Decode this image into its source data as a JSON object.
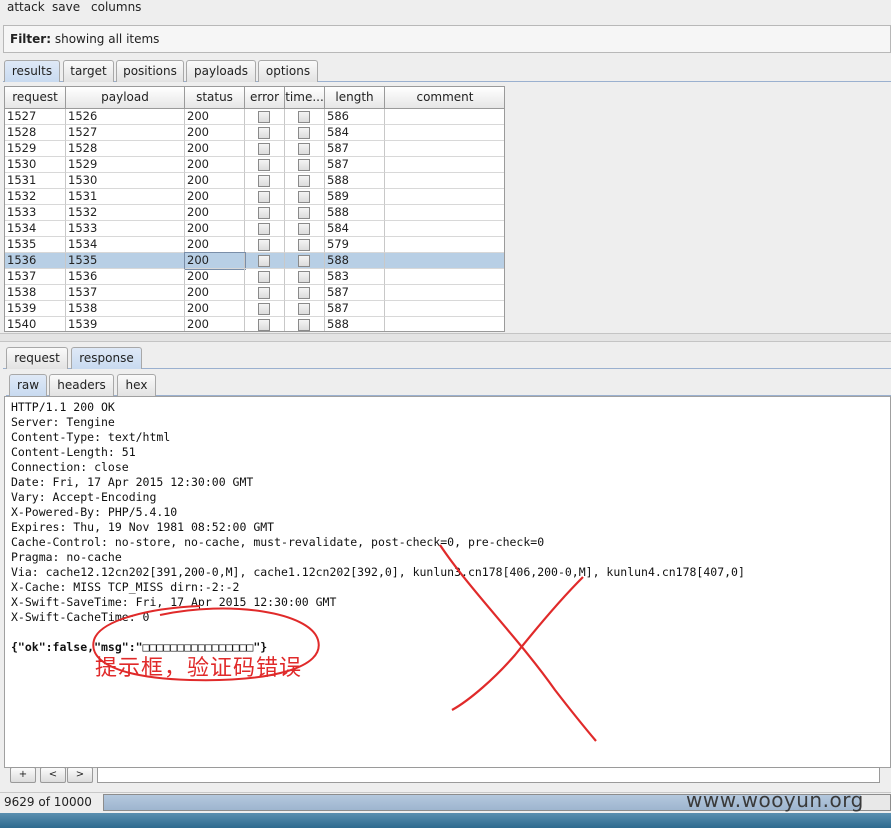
{
  "menu": {
    "attack": "attack",
    "save": "save",
    "columns": "columns"
  },
  "filter": {
    "label": "Filter:",
    "text": "showing all items"
  },
  "main_tabs": [
    {
      "label": "results",
      "active": true
    },
    {
      "label": "target",
      "active": false
    },
    {
      "label": "positions",
      "active": false
    },
    {
      "label": "payloads",
      "active": false
    },
    {
      "label": "options",
      "active": false
    }
  ],
  "table": {
    "columns": [
      "request",
      "payload",
      "status",
      "error",
      "time...",
      "length",
      "comment"
    ],
    "rows": [
      {
        "request": "1527",
        "payload": "1526",
        "status": "200",
        "length": "586"
      },
      {
        "request": "1528",
        "payload": "1527",
        "status": "200",
        "length": "584"
      },
      {
        "request": "1529",
        "payload": "1528",
        "status": "200",
        "length": "587"
      },
      {
        "request": "1530",
        "payload": "1529",
        "status": "200",
        "length": "587"
      },
      {
        "request": "1531",
        "payload": "1530",
        "status": "200",
        "length": "588"
      },
      {
        "request": "1532",
        "payload": "1531",
        "status": "200",
        "length": "589"
      },
      {
        "request": "1533",
        "payload": "1532",
        "status": "200",
        "length": "588"
      },
      {
        "request": "1534",
        "payload": "1533",
        "status": "200",
        "length": "584"
      },
      {
        "request": "1535",
        "payload": "1534",
        "status": "200",
        "length": "579"
      },
      {
        "request": "1536",
        "payload": "1535",
        "status": "200",
        "length": "588",
        "selected": true
      },
      {
        "request": "1537",
        "payload": "1536",
        "status": "200",
        "length": "583"
      },
      {
        "request": "1538",
        "payload": "1537",
        "status": "200",
        "length": "587"
      },
      {
        "request": "1539",
        "payload": "1538",
        "status": "200",
        "length": "587"
      },
      {
        "request": "1540",
        "payload": "1539",
        "status": "200",
        "length": "588"
      }
    ]
  },
  "detail_tabs": [
    {
      "label": "request",
      "active": false
    },
    {
      "label": "response",
      "active": true
    }
  ],
  "view_tabs": [
    {
      "label": "raw",
      "active": true
    },
    {
      "label": "headers",
      "active": false
    },
    {
      "label": "hex",
      "active": false
    }
  ],
  "response": {
    "lines": [
      "HTTP/1.1 200 OK",
      "Server: Tengine",
      "Content-Type: text/html",
      "Content-Length: 51",
      "Connection: close",
      "Date: Fri, 17 Apr 2015 12:30:00 GMT",
      "Vary: Accept-Encoding",
      "X-Powered-By: PHP/5.4.10",
      "Expires: Thu, 19 Nov 1981 08:52:00 GMT",
      "Cache-Control: no-store, no-cache, must-revalidate, post-check=0, pre-check=0",
      "Pragma: no-cache",
      "Via: cache12.12cn202[391,200-0,M], cache1.12cn202[392,0], kunlun3.cn178[406,200-0,M], kunlun4.cn178[407,0]",
      "X-Cache: MISS TCP_MISS dirn:-2:-2",
      "X-Swift-SaveTime: Fri, 17 Apr 2015 12:30:00 GMT",
      "X-Swift-CacheTime: 0"
    ],
    "body": "{\"ok\":false,\"msg\":\"□□□□□□□□□□□□□□□□\"}"
  },
  "annotation": {
    "text": "提示框，验证码错误",
    "color": "#e02a2a"
  },
  "search": {
    "prev_label": "<",
    "next_label": ">",
    "add_label": "+",
    "value": ""
  },
  "status": {
    "text": "9629 of 10000",
    "progress_fraction": 0.9629
  },
  "watermark": "www.wooyun.org"
}
